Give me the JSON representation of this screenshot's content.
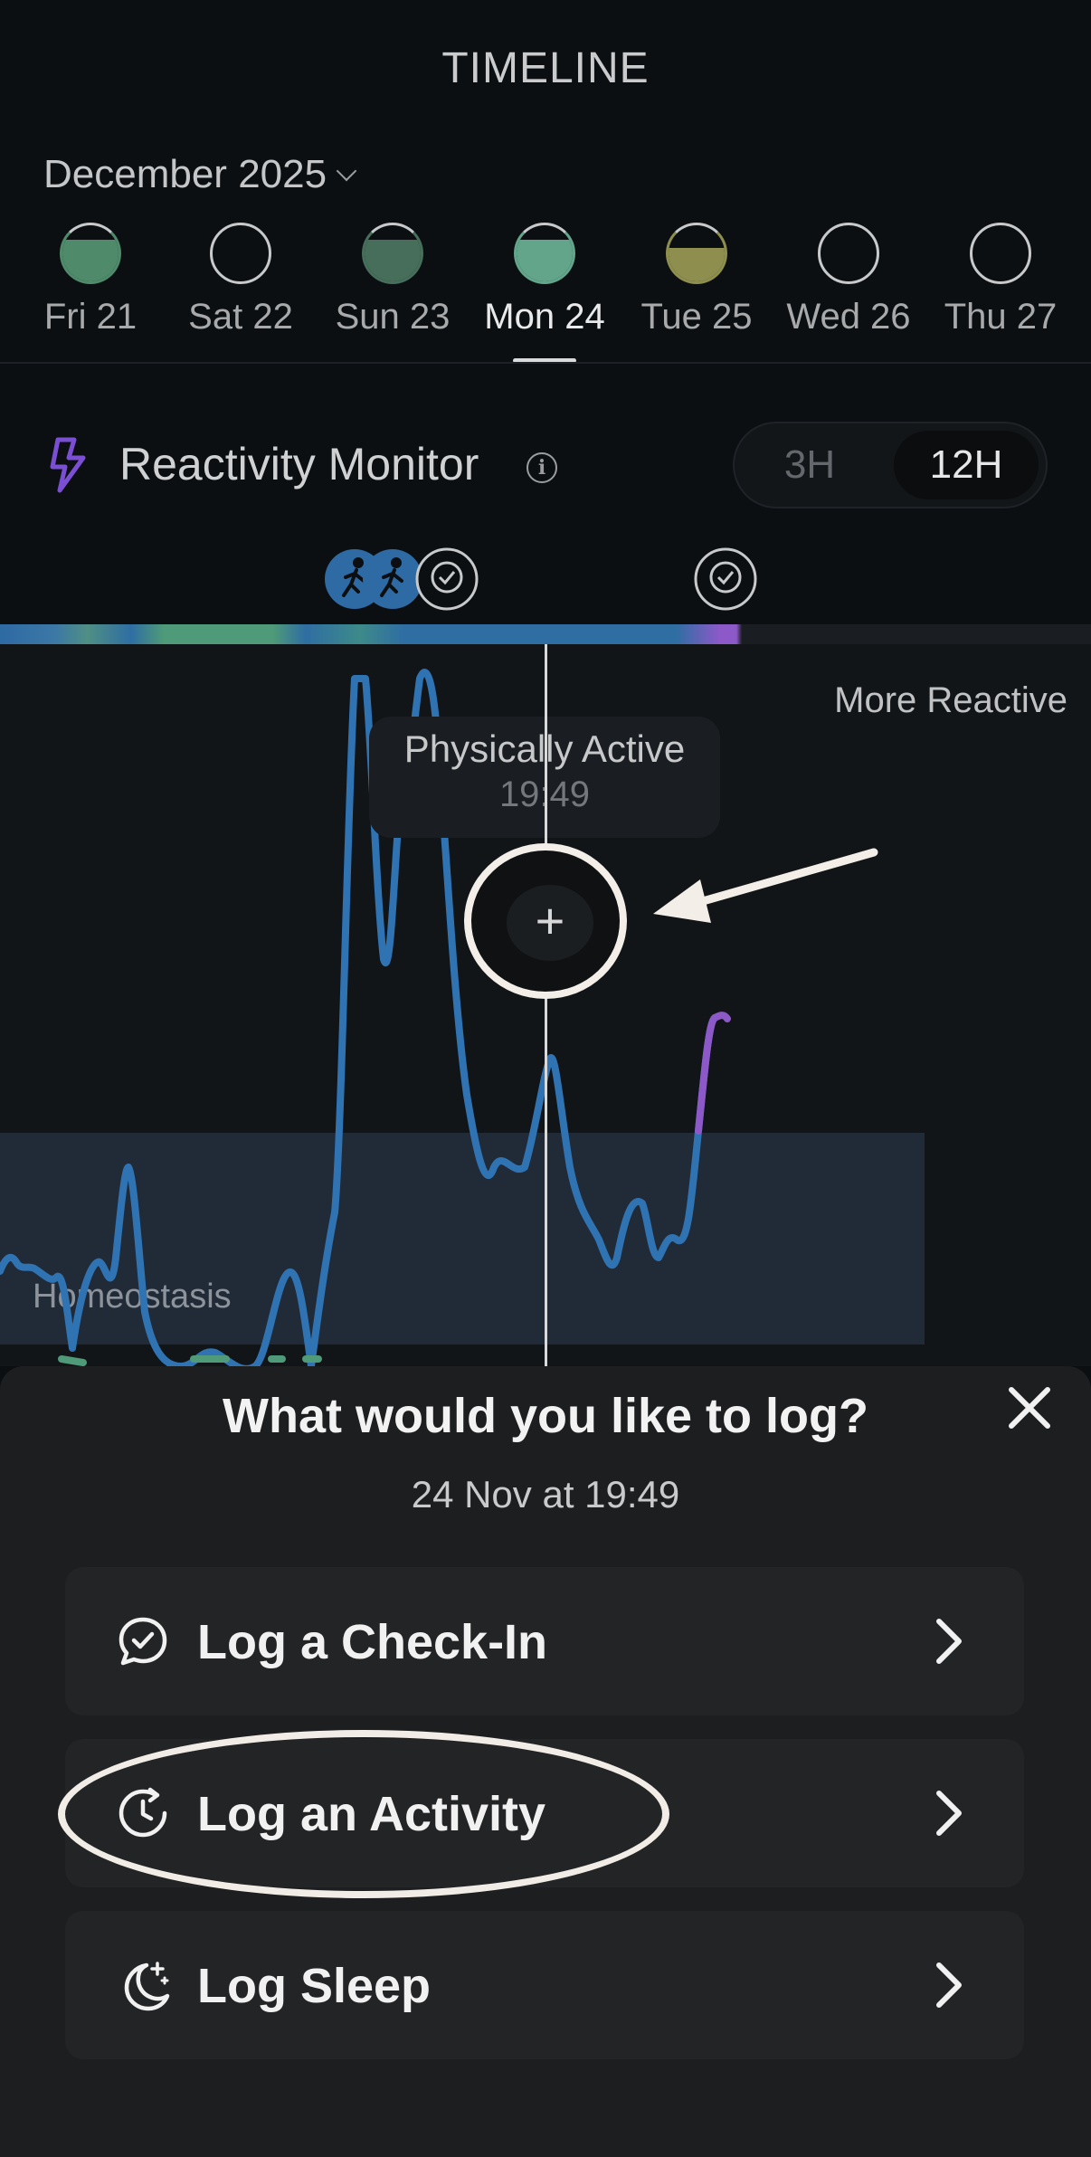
{
  "header": {
    "title": "TIMELINE",
    "month": "December 2025"
  },
  "days": [
    {
      "label": "Fri 21",
      "fill_color": "#4f8a6a",
      "fill_level": 0.75,
      "selected": false
    },
    {
      "label": "Sat 22",
      "fill_color": "",
      "fill_level": 0,
      "selected": false
    },
    {
      "label": "Sun 23",
      "fill_color": "#466e5a",
      "fill_level": 0.75,
      "selected": false
    },
    {
      "label": "Mon 24",
      "fill_color": "#63a58b",
      "fill_level": 0.75,
      "selected": true
    },
    {
      "label": "Tue 25",
      "fill_color": "#8e8f4e",
      "fill_level": 0.6,
      "selected": false
    },
    {
      "label": "Wed 26",
      "fill_color": "",
      "fill_level": 0,
      "selected": false
    },
    {
      "label": "Thu 27",
      "fill_color": "",
      "fill_level": 0,
      "selected": false
    }
  ],
  "monitor": {
    "title": "Reactivity Monitor",
    "toggle": {
      "options": [
        "3H",
        "12H"
      ],
      "selected": "12H"
    },
    "bolt_color": "#7a4fd4"
  },
  "chart": {
    "top_label": "More Reactive",
    "band_label": "Homeostasis",
    "line_color": "#2f73b3",
    "reactive_color": "#8d59c9",
    "tooltip": {
      "activity": "Physically Active",
      "time": "19:49"
    },
    "add_icon": "plus-icon"
  },
  "sheet": {
    "title": "What would you like to log?",
    "subtitle": "24 Nov at 19:49",
    "options": [
      {
        "label": "Log a Check-In",
        "icon": "chat-check-icon"
      },
      {
        "label": "Log an Activity",
        "icon": "clock-refresh-icon"
      },
      {
        "label": "Log Sleep",
        "icon": "moon-stars-icon"
      }
    ]
  }
}
